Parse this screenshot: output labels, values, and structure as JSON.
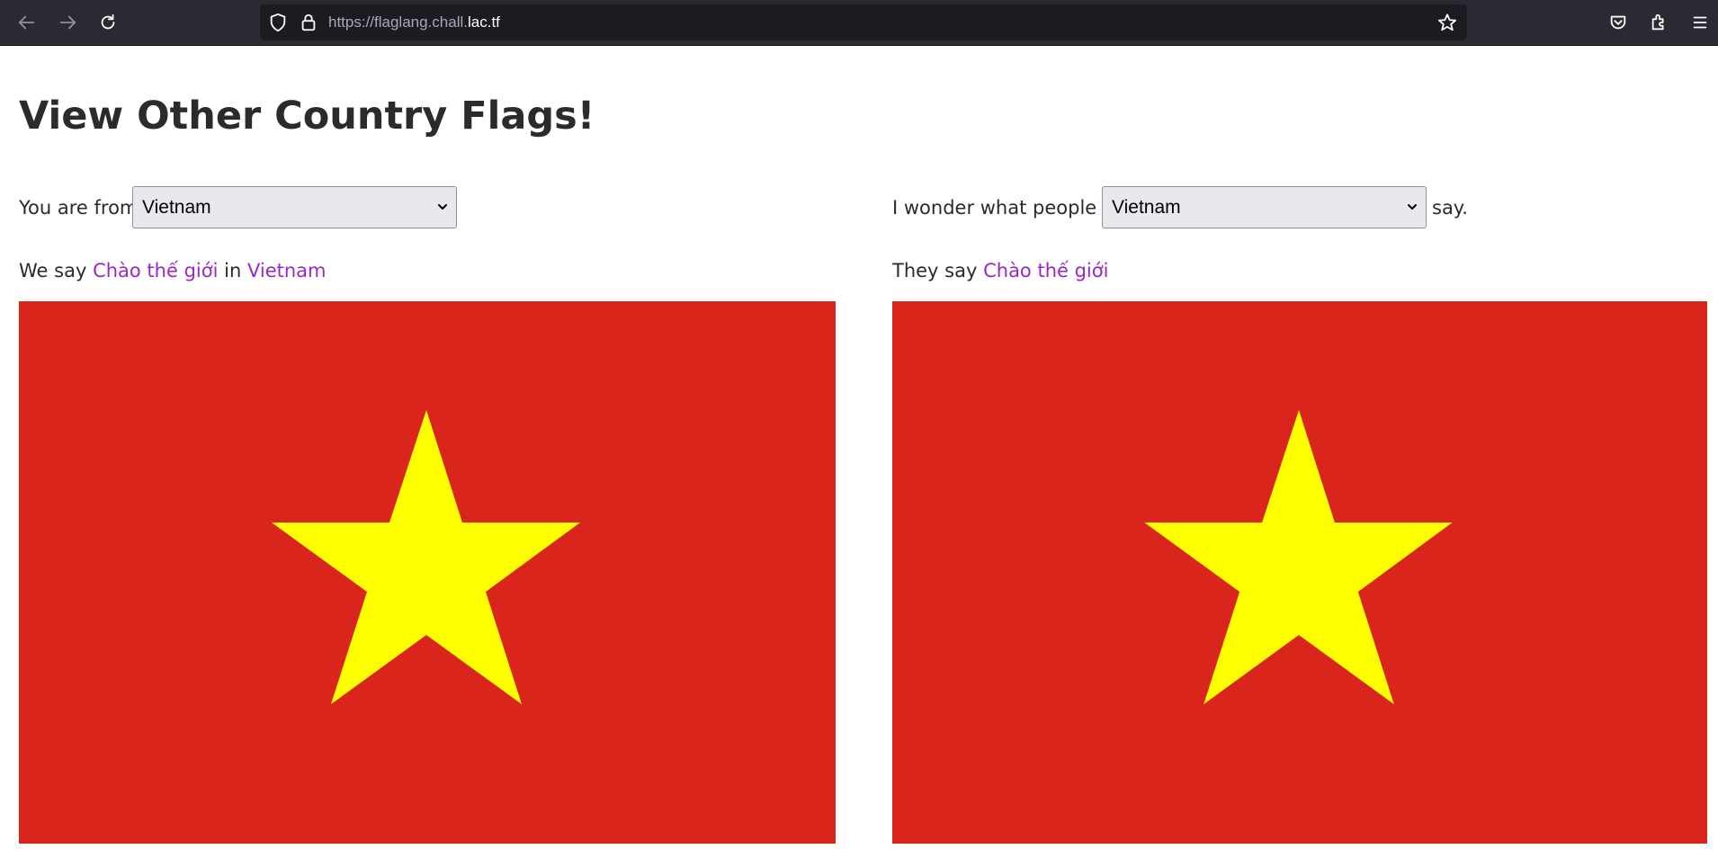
{
  "browser": {
    "url_prefix": "https://flaglang.chall.",
    "url_domain": "lac.tf",
    "icons": {
      "back": "back-arrow-icon",
      "forward": "forward-arrow-icon",
      "reload": "reload-icon",
      "tracking": "shield-icon",
      "secure": "lock-icon",
      "bookmark": "star-outline-icon",
      "pocket": "pocket-icon",
      "extensions": "puzzle-icon",
      "menu": "hamburger-menu-icon"
    }
  },
  "page": {
    "title": "View Other Country Flags!",
    "left": {
      "from_label": "You are from",
      "from_selected": "Vietnam",
      "we_say": "We say",
      "greeting": "Chào thế giới",
      "in_word": "in",
      "country_link": "Vietnam",
      "flag": "vietnam-flag"
    },
    "right": {
      "wonder_label": "I wonder what people in",
      "wonder_selected": "Vietnam",
      "say_suffix": "say.",
      "they_say": "They say",
      "greeting": "Chào thế giới",
      "flag": "vietnam-flag"
    }
  },
  "colors": {
    "flag_red": "#da251d",
    "flag_star": "#ffff00",
    "link_accent": "#9a28c6",
    "chrome_bg": "#2b2a33"
  }
}
